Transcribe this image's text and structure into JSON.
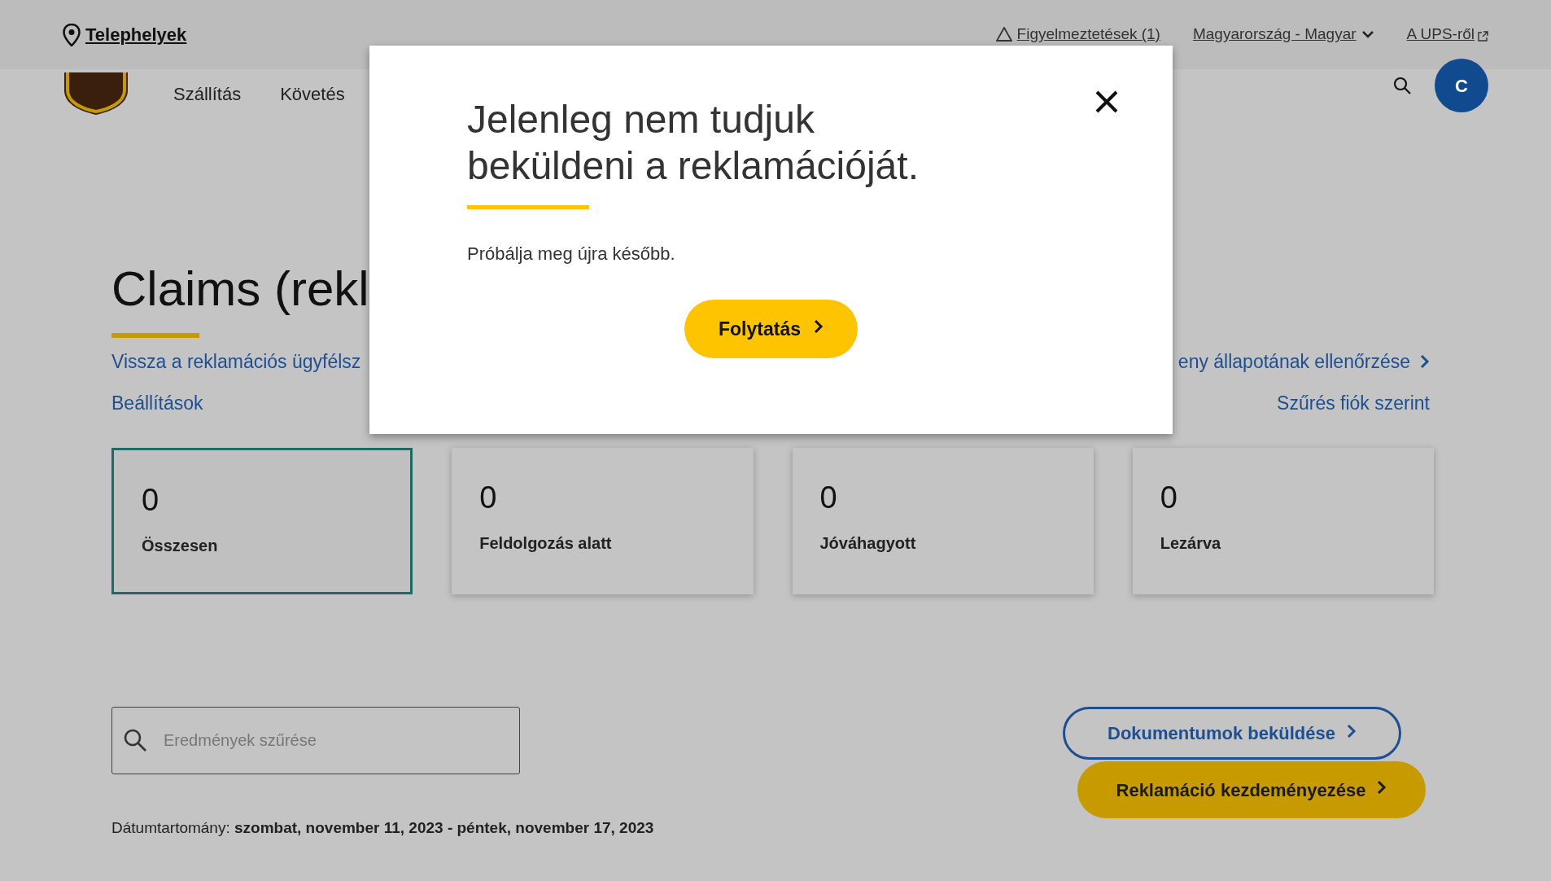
{
  "top_bar": {
    "locations_link": "Telephelyek",
    "alerts": "Figyelmeztetések (1)",
    "language": "Magyarország - Magyar",
    "about": "A UPS-ről"
  },
  "nav": {
    "items": [
      "Szállítás",
      "Követés"
    ],
    "avatar": "C"
  },
  "page": {
    "title": "Claims (rekl",
    "links_left": [
      "Vissza a reklamációs ügyfélsz",
      "Beállítások"
    ],
    "links_right": [
      {
        "label": "eny állapotának ellenőrzése",
        "chevron": true
      },
      {
        "label": "Szűrés fiók szerint",
        "chevron": false
      }
    ]
  },
  "cards": [
    {
      "count": "0",
      "label": "Összesen",
      "selected": true
    },
    {
      "count": "0",
      "label": "Feldolgozás alatt",
      "selected": false
    },
    {
      "count": "0",
      "label": "Jóváhagyott",
      "selected": false
    },
    {
      "count": "0",
      "label": "Lezárva",
      "selected": false
    }
  ],
  "filter": {
    "placeholder": "Eredmények szűrése"
  },
  "actions": [
    {
      "label": "Dokumentumok beküldése",
      "kind": "outline"
    },
    {
      "label": "Reklamáció kezdeményezése",
      "kind": "filled"
    }
  ],
  "date_range": "Dátumtartomány: **szombat, november 11, 2023 - péntek, november 17, 2023**",
  "dialog": {
    "title": "Jelenleg nem tudjuk beküldeni a reklamációját.",
    "message": "Próbálja meg újra később.",
    "button": "Folytatás"
  }
}
